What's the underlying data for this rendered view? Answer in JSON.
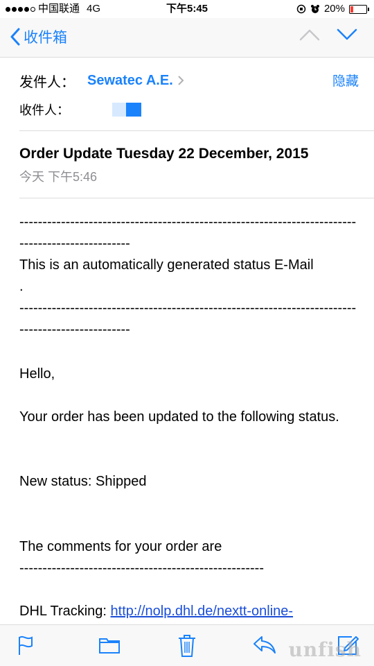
{
  "status_bar": {
    "carrier": "中国联通",
    "network": "4G",
    "time": "下午5:45",
    "battery_percent": "20%",
    "battery_level": 0.2,
    "battery_color": "#ff3b30"
  },
  "nav": {
    "back_label": "收件箱",
    "accent": "#1a82fb"
  },
  "header": {
    "from_label": "发件人：",
    "sender": "Sewatec A.E.",
    "hide_label": "隐藏",
    "to_label": "收件人："
  },
  "message": {
    "subject": "Order Update Tuesday 22 December, 2015",
    "date": "今天 下午5:46"
  },
  "body": {
    "separator_1": "-------------------------------------------------------------------------------------------------",
    "auto_notice": "This is an automatically generated status E-Mail\n.",
    "separator_2": "-------------------------------------------------------------------------------------------------",
    "greeting": "Hello,",
    "update_text": "Your order has been updated to the following status.",
    "new_status": "New status: Shipped",
    "comments_intro": "The comments for your order are",
    "separator_3": "-----------------------------------------------------",
    "tracking_label": "DHL Tracking: ",
    "tracking_link": "http://nolp.dhl.de/nextt-online-"
  },
  "toolbar": {
    "icons": [
      "flag-icon",
      "folder-icon",
      "trash-icon",
      "reply-icon",
      "compose-icon"
    ]
  },
  "watermark": "unfish"
}
